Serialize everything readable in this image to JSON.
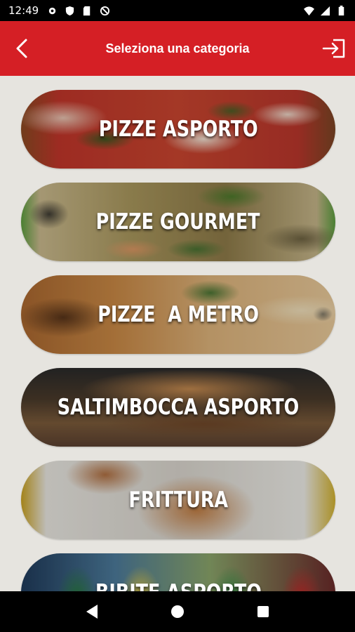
{
  "status_bar": {
    "time": "12:49"
  },
  "app_bar": {
    "title": "Seleziona una categoria",
    "back_icon": "chevron-left-icon",
    "logout_icon": "logout-icon"
  },
  "categories": [
    {
      "label": "PIZZE ASPORTO"
    },
    {
      "label": "PIZZE GOURMET"
    },
    {
      "label": "PIZZE  A METRO"
    },
    {
      "label": "SALTIMBOCCA ASPORTO"
    },
    {
      "label": "FRITTURA"
    },
    {
      "label": "BIBITE ASPORTO"
    }
  ],
  "colors": {
    "accent": "#d51f25",
    "background": "#e6e4df"
  }
}
